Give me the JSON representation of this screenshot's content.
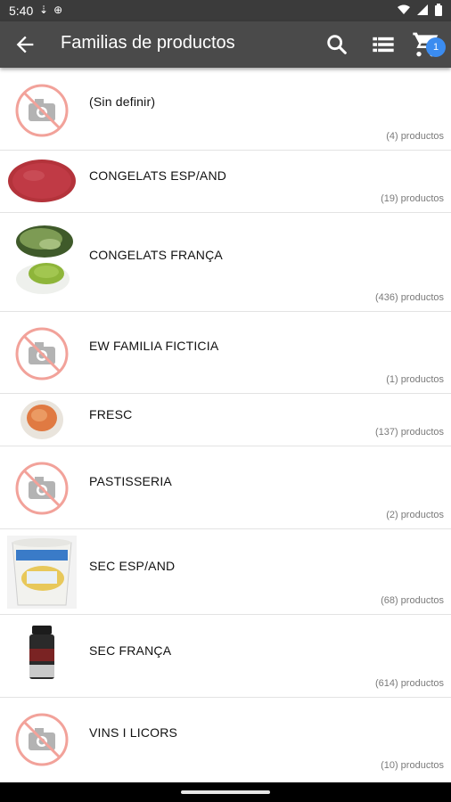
{
  "status_bar": {
    "time": "5:40",
    "icons": [
      "usb-icon",
      "vpn-icon",
      "wifi-icon",
      "signal-icon",
      "battery-icon"
    ]
  },
  "app_bar": {
    "title": "Familias de productos",
    "icons": [
      "back-arrow-icon",
      "search-icon",
      "list-view-icon",
      "shopping-cart-icon"
    ],
    "cart_badge": "1",
    "colors": {
      "background": "#4a4a4a",
      "badge": "#3b8cf0"
    }
  },
  "families": [
    {
      "name": "(Sin definir)",
      "count": "(4) productos",
      "image": "no-photo-icon"
    },
    {
      "name": "CONGELATS ESP/AND",
      "count": "(19) productos",
      "image": "burger-patty-photo"
    },
    {
      "name": "CONGELATS FRANÇA",
      "count": "(436) productos",
      "image": "green-peas-photo"
    },
    {
      "name": "EW FAMILIA FICTICIA",
      "count": "(1) productos",
      "image": "no-photo-icon"
    },
    {
      "name": "FRESC",
      "count": "(137) productos",
      "image": "lentils-bowl-photo"
    },
    {
      "name": "PASTISSERIA",
      "count": "(2) productos",
      "image": "no-photo-icon"
    },
    {
      "name": "SEC ESP/AND",
      "count": "(68) productos",
      "image": "bucket-product-photo"
    },
    {
      "name": "SEC FRANÇA",
      "count": "(614) productos",
      "image": "spice-jar-photo"
    },
    {
      "name": "VINS I LICORS",
      "count": "(10) productos",
      "image": "no-photo-icon"
    }
  ]
}
